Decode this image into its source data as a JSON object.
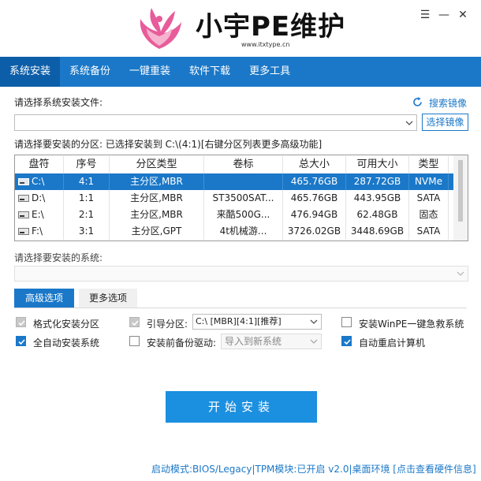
{
  "header": {
    "title": "小宇PE维护",
    "url": "www.itxtype.cn",
    "menu_glyph": "☰",
    "min_glyph": "—",
    "close_glyph": "✕"
  },
  "tabs": [
    {
      "label": "系统安装",
      "active": true
    },
    {
      "label": "系统备份",
      "active": false
    },
    {
      "label": "一键重装",
      "active": false
    },
    {
      "label": "软件下载",
      "active": false
    },
    {
      "label": "更多工具",
      "active": false
    }
  ],
  "file_section": {
    "label": "请选择系统安装文件:",
    "search_label": "搜索镜像",
    "file_value": "",
    "choose_button": "选择镜像"
  },
  "partition_section": {
    "label": "请选择要安装的分区: 已选择安装到 C:\\(4:1)[右键分区列表更多高级功能]"
  },
  "table": {
    "headers": [
      "盘符",
      "序号",
      "分区类型",
      "卷标",
      "总大小",
      "可用大小",
      "类型"
    ],
    "rows": [
      {
        "drive": "C:\\",
        "index": "4:1",
        "ptype": "主分区,MBR",
        "label": "",
        "total": "465.76GB",
        "free": "287.72GB",
        "type": "NVMe",
        "selected": true
      },
      {
        "drive": "D:\\",
        "index": "1:1",
        "ptype": "主分区,MBR",
        "label": "ST3500SAT...",
        "total": "465.76GB",
        "free": "443.95GB",
        "type": "SATA",
        "selected": false
      },
      {
        "drive": "E:\\",
        "index": "2:1",
        "ptype": "主分区,MBR",
        "label": "来酷500G...",
        "total": "476.94GB",
        "free": "62.48GB",
        "type": "固态",
        "selected": false
      },
      {
        "drive": "F:\\",
        "index": "3:1",
        "ptype": "主分区,GPT",
        "label": "4t机械游...",
        "total": "3726.02GB",
        "free": "3448.69GB",
        "type": "SATA",
        "selected": false
      }
    ]
  },
  "system_section": {
    "label": "请选择要安装的系统:",
    "value": ""
  },
  "option_tabs": {
    "advanced": "高级选项",
    "more": "更多选项"
  },
  "options": {
    "format": {
      "label": "格式化安装分区",
      "checked": true,
      "disabled": true
    },
    "boot": {
      "label": "引导分区:",
      "checked": true,
      "disabled": true,
      "value": "C:\\ [MBR][4:1][推荐]"
    },
    "winpe": {
      "label": "安装WinPE一键急救系统",
      "checked": false
    },
    "auto": {
      "label": "全自动安装系统",
      "checked": true
    },
    "backup": {
      "label": "安装前备份驱动:",
      "checked": false,
      "value": "导入到新系统"
    },
    "reboot": {
      "label": "自动重启计算机",
      "checked": true
    }
  },
  "start_button": "开始安装",
  "footer": "启动模式:BIOS/Legacy|TPM模块:已开启 v2.0|桌面环境 [点击查看硬件信息]",
  "colors": {
    "accent": "#1b78c8",
    "tab_active": "#0d5ea8",
    "logo_pink": "#e85c9a",
    "start_button": "#1b8fe0"
  }
}
